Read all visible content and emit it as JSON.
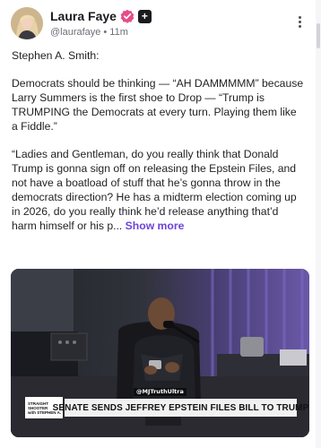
{
  "post": {
    "author": {
      "name": "Laura Faye",
      "handle": "@laurafaye",
      "time": "11m",
      "separator": "•",
      "verified_icon": "verified-badge-icon",
      "plus_badge": "+"
    },
    "body": {
      "attribution": "Stephen A. Smith:",
      "paragraph_1": "Democrats should be thinking — “AH DAMMMMM” because Larry Summers is the first shoe to Drop — “Trump is TRUMPING the Democrats at every turn. Playing them like a Fiddle.”",
      "paragraph_2": "“Ladies and Gentleman, do you really think that Donald Trump is gonna sign off on releasing the Epstein Files, and not have a boatload of stuff that he’s gonna throw in the democrats direction? He has a midterm election coming up in 2026, do you really think he’d release anything that’d harm himself or his p...",
      "show_more": "Show more"
    },
    "media": {
      "watermark": "@MJTruthUltra",
      "logo_line_1": "STRAIGHT",
      "logo_line_2": "SHOOTER",
      "logo_line_3": "with STEPHEN A.",
      "headline": "SENATE SENDS JEFFREY EPSTEIN FILES BILL TO TRUMP"
    }
  },
  "colors": {
    "accent": "#6d43d9",
    "verified": "#e64c8a"
  },
  "icons": {
    "more": "more-vertical-icon"
  }
}
